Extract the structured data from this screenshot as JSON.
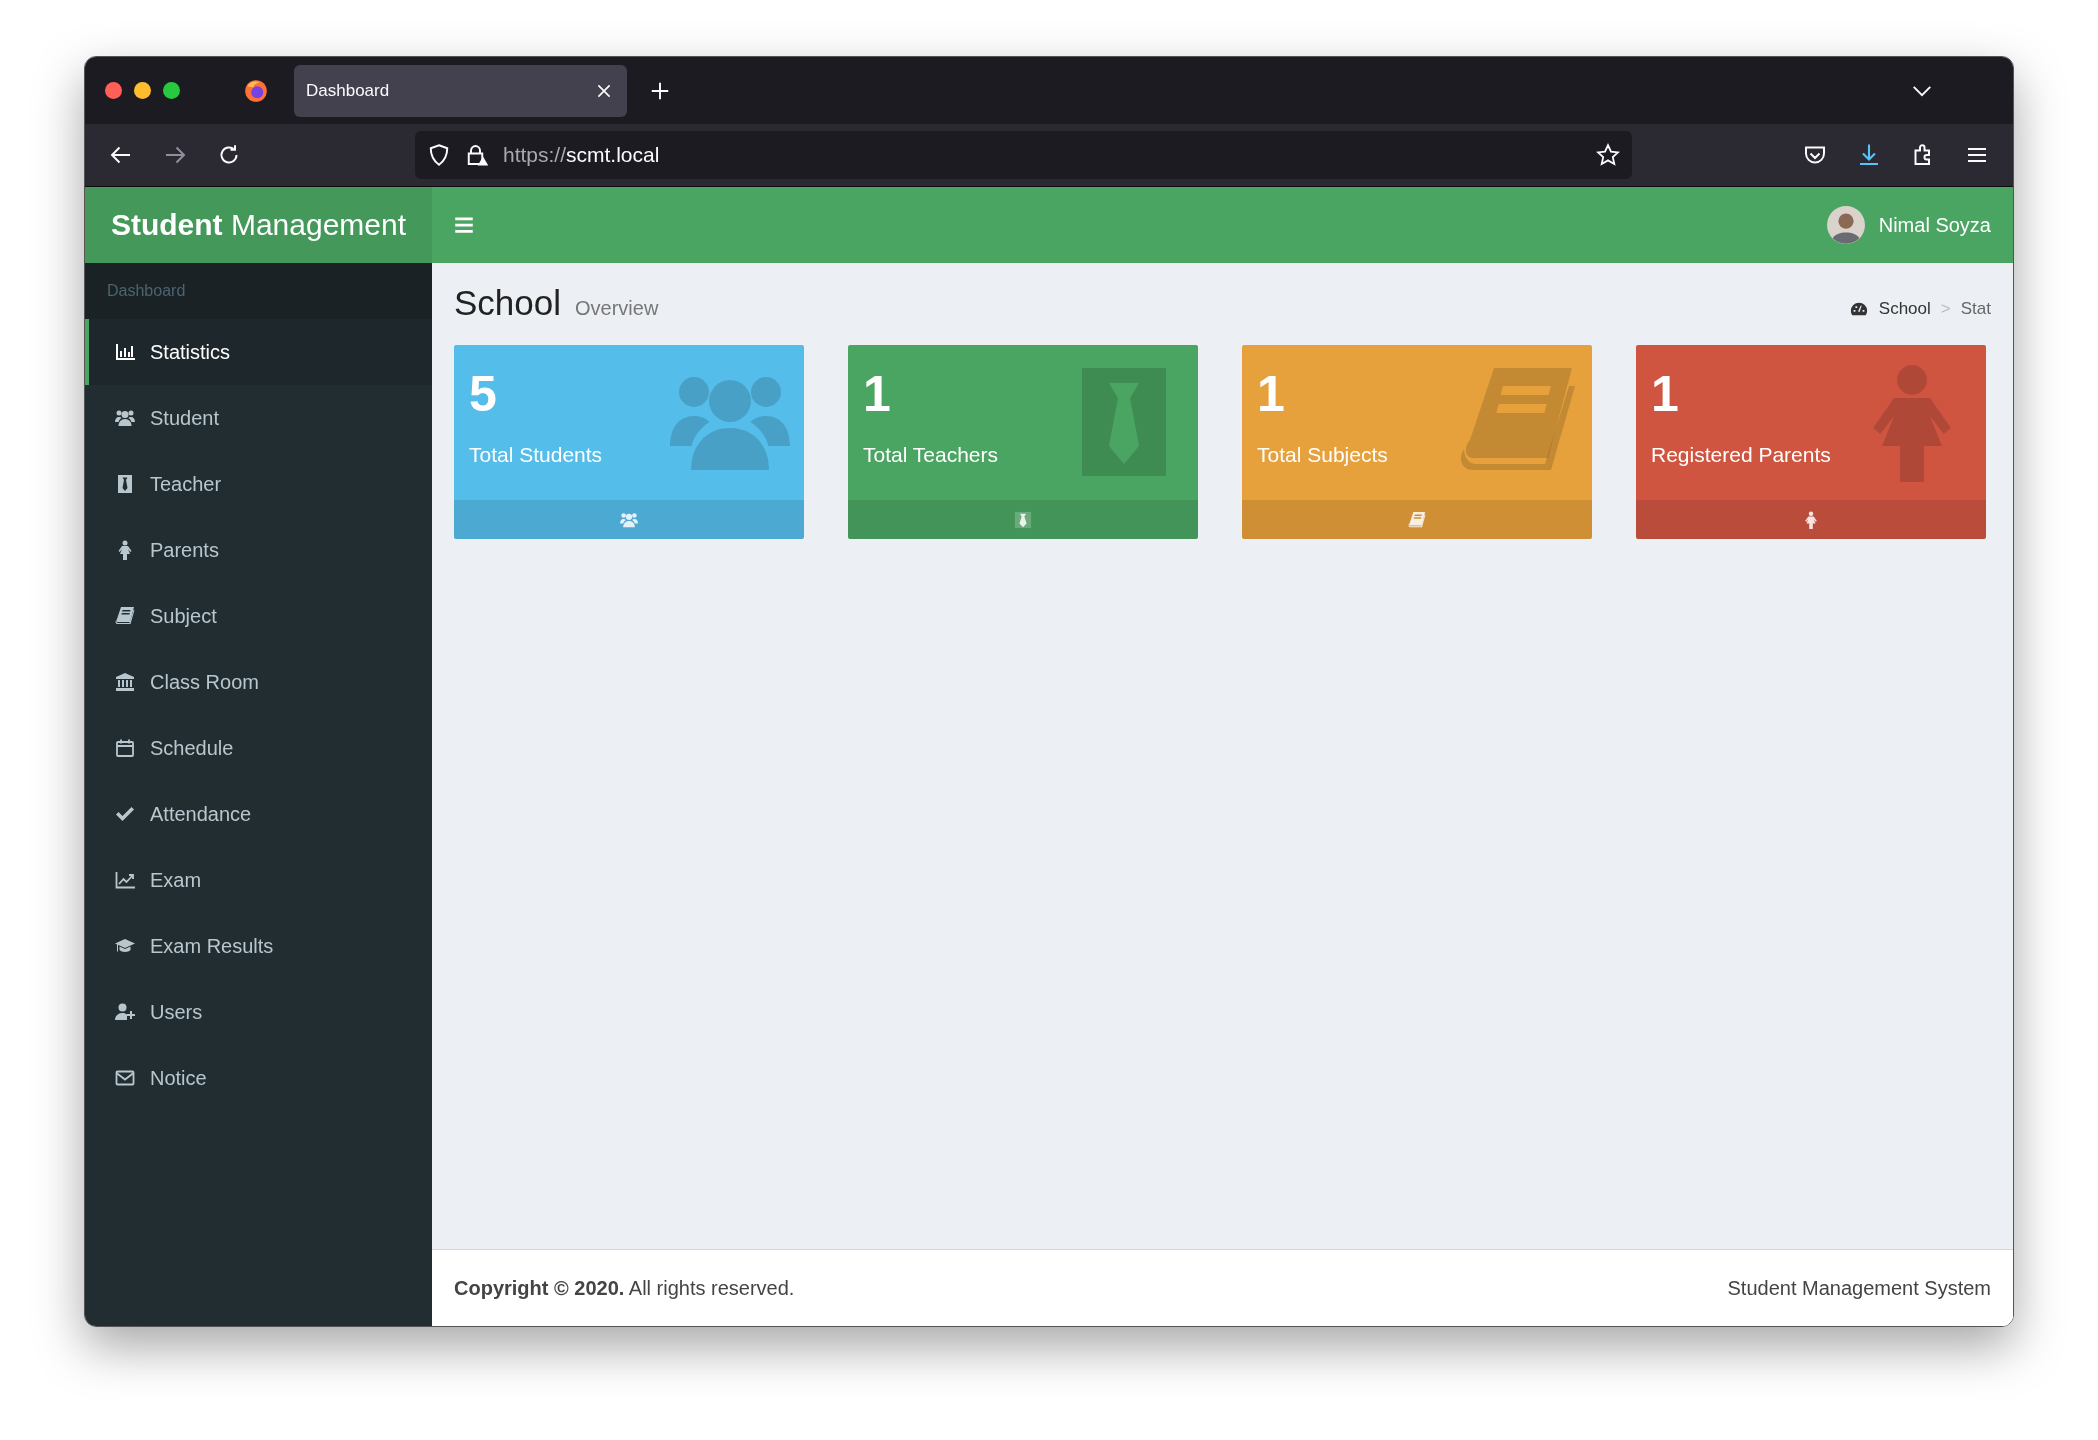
{
  "browser": {
    "tab": {
      "title": "Dashboard"
    },
    "address": {
      "scheme": "https://",
      "host": "scmt.local"
    }
  },
  "header": {
    "brand": "**Student** Management",
    "user": {
      "name": "Nimal Soyza"
    }
  },
  "sidebar": {
    "heading": "Dashboard",
    "items": [
      {
        "label": "Statistics",
        "selected": true
      },
      {
        "label": "Student",
        "selected": false
      },
      {
        "label": "Teacher",
        "selected": false
      },
      {
        "label": "Parents",
        "selected": false
      },
      {
        "label": "Subject",
        "selected": false
      },
      {
        "label": "Class Room",
        "selected": false
      },
      {
        "label": "Schedule",
        "selected": false
      },
      {
        "label": "Attendance",
        "selected": false
      },
      {
        "label": "Exam",
        "selected": false
      },
      {
        "label": "Exam Results",
        "selected": false
      },
      {
        "label": "Users",
        "selected": false
      },
      {
        "label": "Notice",
        "selected": false
      }
    ]
  },
  "page": {
    "title": "School",
    "subtitle": "Overview",
    "breadcrumb": [
      "School",
      "Stat"
    ],
    "breadcrumb_separator": ">"
  },
  "cards": [
    {
      "kind": "students",
      "count": "5",
      "label": "Total Students",
      "color": "#55bde9"
    },
    {
      "kind": "teachers",
      "count": "1",
      "label": "Total Teachers",
      "color": "#4aa562"
    },
    {
      "kind": "subjects",
      "count": "1",
      "label": "Total Subjects",
      "color": "#e7a13c"
    },
    {
      "kind": "parents",
      "count": "1",
      "label": "Registered Parents",
      "color": "#cf5541"
    }
  ],
  "footer": {
    "copyright": "**Copyright © 2020.** All rights reserved.",
    "system": "Student Management System"
  }
}
